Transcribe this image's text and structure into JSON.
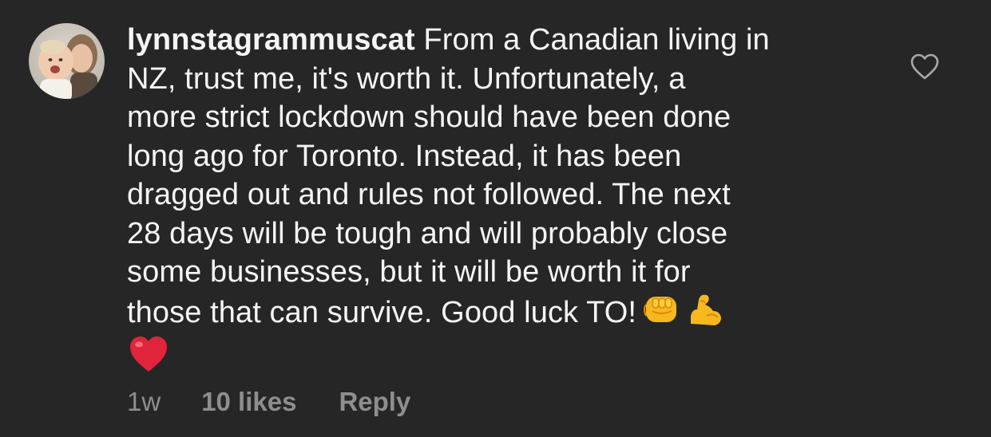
{
  "comment": {
    "username": "lynnstagrammuscat",
    "text_lines": [
      "From a Canadian living in",
      "NZ, trust me, it's worth it. Unfortunately, a",
      "more strict lockdown should have been done",
      "long ago for Toronto. Instead, it has been",
      "dragged out and rules not followed. The next",
      "28 days will be tough and will probably close",
      "some businesses, but it will be worth it for",
      "those that can survive. Good luck TO!"
    ],
    "emojis": [
      "oncoming-fist-emoji",
      "flexed-biceps-emoji",
      "red-heart-emoji"
    ],
    "avatar_icon": "profile-photo-avatar",
    "like_icon": "heart-outline-icon"
  },
  "meta": {
    "time": "1w",
    "likes": "10 likes",
    "reply": "Reply"
  },
  "colors": {
    "background": "#262626",
    "text": "#f5f5f5",
    "meta": "#8e8e8e"
  }
}
